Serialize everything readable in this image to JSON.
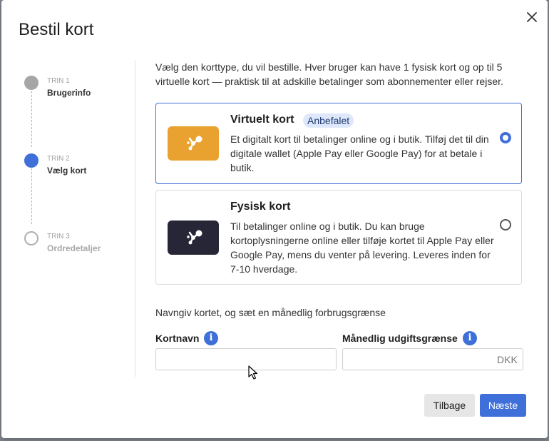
{
  "modal": {
    "title": "Bestil kort"
  },
  "steps": [
    {
      "num": "TRIN 1",
      "label": "Brugerinfo",
      "state": "done"
    },
    {
      "num": "TRIN 2",
      "label": "Vælg kort",
      "state": "active"
    },
    {
      "num": "TRIN 3",
      "label": "Ordredetaljer",
      "state": "todo"
    }
  ],
  "intro": "Vælg den korttype, du vil bestille. Hver bruger kan have 1 fysisk kort og op til 5 virtuelle kort — praktisk til at adskille betalinger som abonnementer eller rejser.",
  "cards": [
    {
      "title": "Virtuelt kort",
      "badge": "Anbefalet",
      "description": "Et digitalt kort til betalinger online og i butik. Tilføj det til din digitale wallet (Apple Pay eller Google Pay) for at betale i butik.",
      "selected": true,
      "color": "#e9a22f"
    },
    {
      "title": "Fysisk kort",
      "description": "Til betalinger online og i butik. Du kan bruge kortoplysningerne online eller tilføje kortet til Apple Pay eller Google Pay, mens du venter på levering. Leveres inden for 7-10 hverdage.",
      "selected": false,
      "color": "#262637"
    }
  ],
  "form": {
    "intro": "Navngiv kortet, og sæt en månedlig forbrugsgrænse",
    "card_name": {
      "label": "Kortnavn",
      "value": "",
      "placeholder": ""
    },
    "monthly_limit": {
      "label": "Månedlig udgiftsgrænse",
      "value": "",
      "placeholder": "",
      "currency": "DKK"
    }
  },
  "buttons": {
    "back": "Tilbage",
    "next": "Næste"
  },
  "icons": {
    "close": "close-icon",
    "info": "info-icon",
    "card_logo": "card-logo-icon"
  },
  "colors": {
    "accent": "#3f6fd8",
    "virtual_card": "#e9a22f",
    "physical_card": "#262637"
  }
}
